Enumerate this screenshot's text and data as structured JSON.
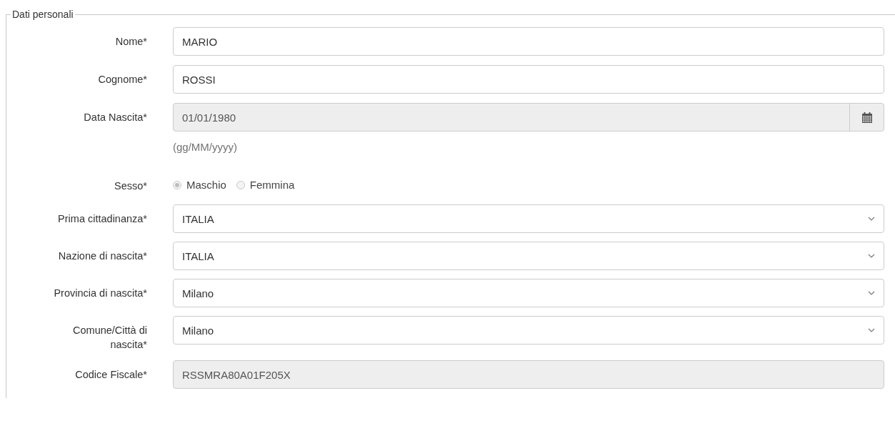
{
  "section": {
    "legend": "Dati personali"
  },
  "fields": [
    {
      "kind": "text",
      "label": "Nome*",
      "value": "MARIO",
      "disabled": false
    },
    {
      "kind": "text",
      "label": "Cognome*",
      "value": "ROSSI",
      "disabled": false
    },
    {
      "kind": "date",
      "label": "Data Nascita*",
      "value": "01/01/1980",
      "disabled": true,
      "hint": "(gg/MM/yyyy)"
    },
    {
      "kind": "radio",
      "label": "Sesso*",
      "disabled": true,
      "options": [
        {
          "label": "Maschio",
          "selected": true
        },
        {
          "label": "Femmina",
          "selected": false
        }
      ]
    },
    {
      "kind": "select",
      "label": "Prima cittadinanza*",
      "value": "ITALIA",
      "disabled": false
    },
    {
      "kind": "select",
      "label": "Nazione di nascita*",
      "value": "ITALIA",
      "disabled": false
    },
    {
      "kind": "select",
      "label": "Provincia di nascita*",
      "value": "Milano",
      "disabled": false
    },
    {
      "kind": "select",
      "label": "Comune/Città di nascita*",
      "value": "Milano",
      "disabled": false
    },
    {
      "kind": "text",
      "label": "Codice Fiscale*",
      "value": "RSSMRA80A01F205X",
      "disabled": true
    }
  ]
}
